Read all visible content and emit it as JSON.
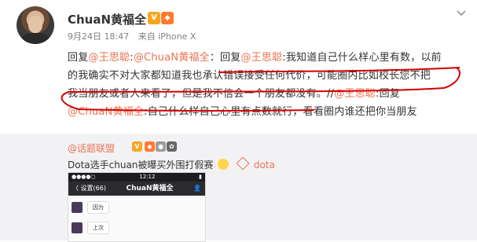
{
  "post": {
    "username": "ChuaN黄福全",
    "badge_v": "V",
    "badge_lv": "◆",
    "date": "9月24日 18:47",
    "source": "来自 iPhone X",
    "lines": [
      [
        {
          "t": "回复",
          "m": false
        },
        {
          "t": "@王思聪",
          "m": true
        },
        {
          "t": ":",
          "m": false
        },
        {
          "t": "@ChuaN黄福全",
          "m": true
        },
        {
          "t": "：回复",
          "m": false
        },
        {
          "t": "@王思聪",
          "m": true
        },
        {
          "t": ":我知道自己什么样心里有数，以前",
          "m": false
        }
      ],
      [
        {
          "t": "的我确实不对大家都知道我也承认错误接受任何代价，可能圈内比如校长您不把",
          "m": false
        }
      ],
      [
        {
          "t": "我当朋友或者人来看了，但是我不信会一个朋友都没有。//",
          "m": false
        },
        {
          "t": "@王思聪",
          "m": true
        },
        {
          "t": ":回复",
          "m": false
        }
      ],
      [
        {
          "t": "@ChuaN黄福全",
          "m": true
        },
        {
          "t": ":自己什么样自己心里有点数就行，看看圈内谁还把你当朋友",
          "m": false
        }
      ]
    ]
  },
  "repost": {
    "user": "@话题联盟",
    "text": "Dota选手chuan被曝买外围打假赛",
    "tag": "dota",
    "badges": [
      "V",
      "◆",
      "●",
      "✿"
    ]
  },
  "phone": {
    "time": "12:12",
    "signal": "●●●●○",
    "battery": "▮",
    "back": "〈 设置(66)",
    "title": "ChuaN黄福全",
    "person": "👤",
    "msgs": [
      "因为",
      "上次"
    ]
  }
}
